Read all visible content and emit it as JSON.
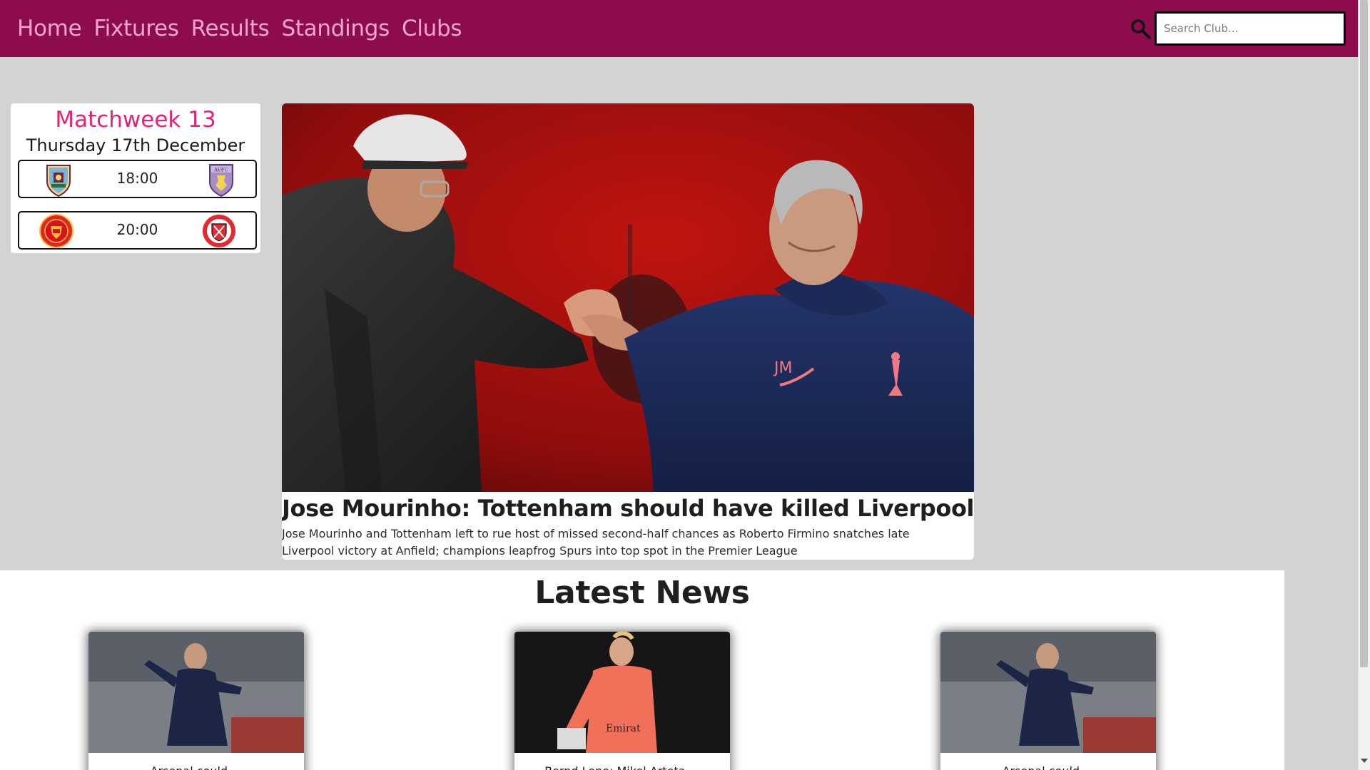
{
  "nav": {
    "items": [
      {
        "label": "Home"
      },
      {
        "label": "Fixtures"
      },
      {
        "label": "Results"
      },
      {
        "label": "Standings"
      },
      {
        "label": "Clubs"
      }
    ],
    "search": {
      "placeholder": "Search Club..."
    }
  },
  "matchweek": {
    "title": "Matchweek 13",
    "date": "Thursday 17th December",
    "fixtures": [
      {
        "time": "18:00",
        "home_crest": "burnley-crest",
        "away_crest": "aston-villa-crest"
      },
      {
        "time": "20:00",
        "home_crest": "man-united-crest",
        "away_crest": "sheffield-united-crest"
      }
    ]
  },
  "feature": {
    "image": "managers-handshake-photo",
    "title": "Jose Mourinho: Tottenham should have killed Liverpool game off",
    "description": "Jose Mourinho and Tottenham left to rue host of missed second-half chances as Roberto Firmino snatches late Liverpool victory at Anfield; champions leapfrog Spurs into top spot in the Premier League"
  },
  "latest_news": {
    "heading": "Latest News",
    "cards": [
      {
        "image": "arteta-touchline-photo",
        "text": "Arsenal could ... "
      },
      {
        "image": "goalkeeper-orange-kit-photo",
        "text": "Bernd Leno: Mikel Arteta ..."
      },
      {
        "image": "arteta-touchline-photo",
        "text": "Arsenal could ..."
      }
    ]
  },
  "colors": {
    "brand": "#8c0c4e",
    "nav_text": "#f0a6cd",
    "accent": "#e8207a",
    "page_bg": "#d3d3d3"
  }
}
